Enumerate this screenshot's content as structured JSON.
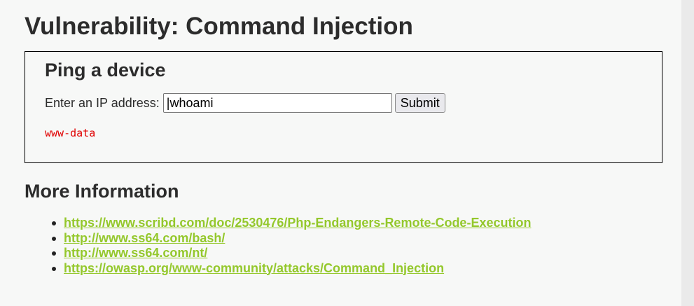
{
  "page": {
    "title": "Vulnerability: Command Injection"
  },
  "ping_section": {
    "heading": "Ping a device",
    "ip_label": "Enter an IP address:",
    "ip_value": "|whoami",
    "submit_label": "Submit",
    "output": "www-data"
  },
  "more_info": {
    "heading": "More Information",
    "links": [
      "https://www.scribd.com/doc/2530476/Php-Endangers-Remote-Code-Execution",
      "http://www.ss64.com/bash/",
      "http://www.ss64.com/nt/",
      "https://owasp.org/www-community/attacks/Command_Injection"
    ]
  },
  "colors": {
    "link": "#94c82c",
    "output_text": "#e00000",
    "background": "#f7f8f7"
  }
}
